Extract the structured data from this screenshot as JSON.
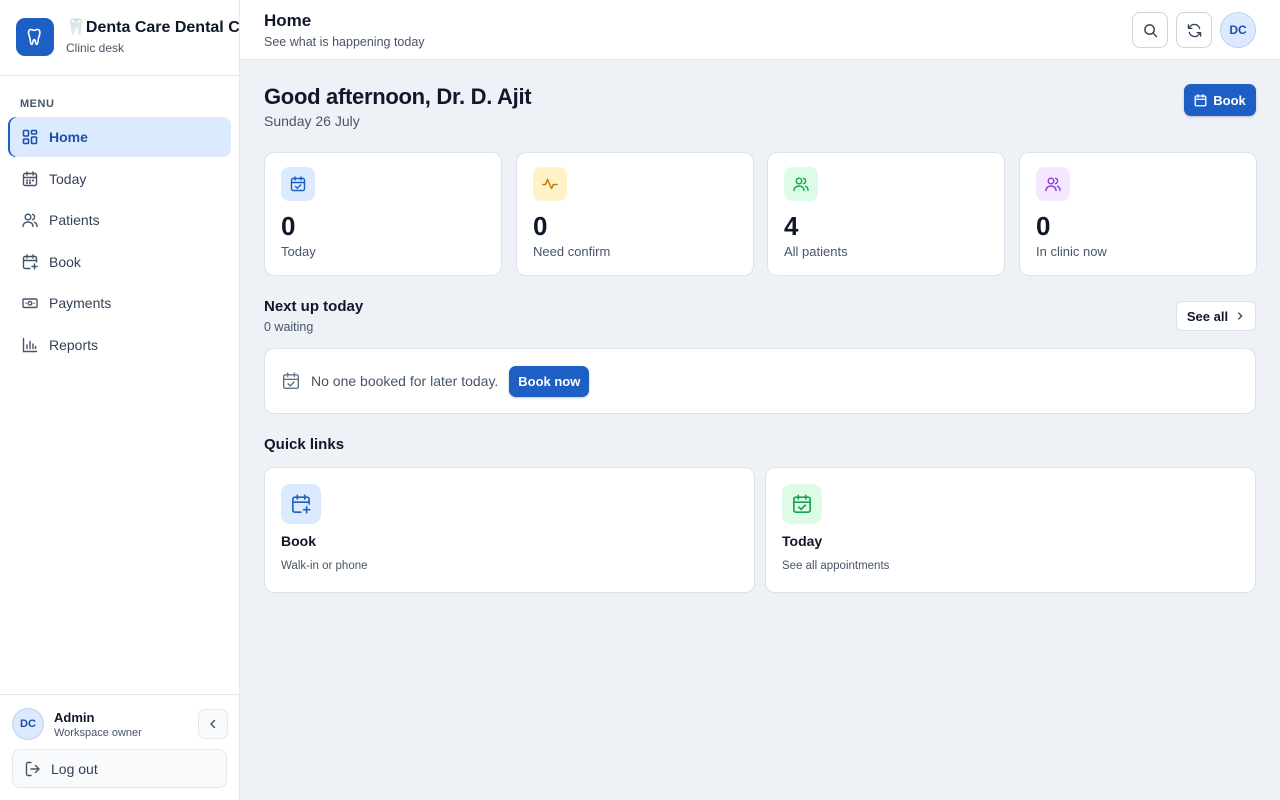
{
  "brand": {
    "emoji": "🦷",
    "name": "Denta Care Dental Clinic",
    "subtitle": "Clinic desk"
  },
  "sidebar": {
    "menu_label": "MENU",
    "items": [
      {
        "label": "Home",
        "icon": "grid-icon",
        "active": true
      },
      {
        "label": "Today",
        "icon": "calendar-icon"
      },
      {
        "label": "Patients",
        "icon": "users-icon"
      },
      {
        "label": "Book",
        "icon": "calendar-plus-icon"
      },
      {
        "label": "Payments",
        "icon": "banknote-icon"
      },
      {
        "label": "Reports",
        "icon": "bar-chart-icon"
      }
    ],
    "user": {
      "initials": "DC",
      "name": "Admin",
      "role": "Workspace owner"
    },
    "logout_label": "Log out"
  },
  "header": {
    "title": "Home",
    "subtitle": "See what is happening today",
    "avatar_initials": "DC"
  },
  "main": {
    "greeting": "Good afternoon, Dr. D. Ajit",
    "date": "Sunday 26 July",
    "book_label": "Book",
    "stats": [
      {
        "value": "0",
        "label": "Today",
        "icon": "calendar-check-icon",
        "color": "#1d5fc4",
        "bg": "#dbeafe"
      },
      {
        "value": "0",
        "label": "Need confirm",
        "icon": "activity-icon",
        "color": "#c2760c",
        "bg": "#fef3c7"
      },
      {
        "value": "4",
        "label": "All patients",
        "icon": "users-icon",
        "color": "#16a34a",
        "bg": "#dcfce7"
      },
      {
        "value": "0",
        "label": "In clinic now",
        "icon": "users-icon",
        "color": "#9333ea",
        "bg": "#f3e8ff"
      }
    ],
    "next_up": {
      "title": "Next up today",
      "subtitle": "0 waiting",
      "see_all_label": "See all",
      "empty_text": "No one booked for later today.",
      "book_now_label": "Book now"
    },
    "quick_links": {
      "title": "Quick links",
      "items": [
        {
          "title": "Book",
          "subtitle": "Walk-in or phone",
          "icon": "calendar-plus-icon",
          "color": "#1d5fc4",
          "bg": "#dbeafe"
        },
        {
          "title": "Today",
          "subtitle": "See all appointments",
          "icon": "calendar-check-icon",
          "color": "#16a34a",
          "bg": "#dcfce7"
        }
      ]
    }
  }
}
